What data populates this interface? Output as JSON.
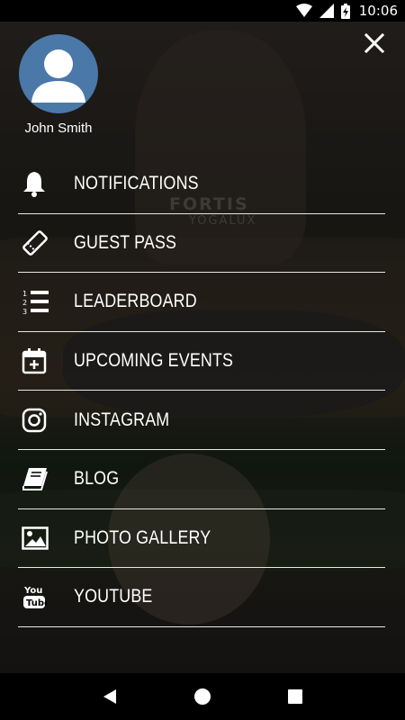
{
  "status_bar": {
    "time": "10:06",
    "icons": [
      "wifi-icon",
      "cellular-icon",
      "battery-charging-icon"
    ]
  },
  "drawer": {
    "close_icon": "close-icon",
    "user": {
      "name": "John Smith",
      "avatar_icon": "default-avatar-icon"
    },
    "menu": [
      {
        "label": "NOTIFICATIONS",
        "icon": "bell-icon"
      },
      {
        "label": "GUEST PASS",
        "icon": "ticket-icon"
      },
      {
        "label": "LEADERBOARD",
        "icon": "numbered-list-icon"
      },
      {
        "label": "UPCOMING EVENTS",
        "icon": "calendar-add-icon"
      },
      {
        "label": "INSTAGRAM",
        "icon": "instagram-icon"
      },
      {
        "label": "BLOG",
        "icon": "book-icon"
      },
      {
        "label": "PHOTO GALLERY",
        "icon": "image-icon"
      },
      {
        "label": "YOUTUBE",
        "icon": "youtube-icon"
      }
    ]
  },
  "background": {
    "shirt_text_line1": "FORTIS",
    "shirt_text_line2": "YOGALUX"
  },
  "nav_bar": {
    "buttons": [
      "back-icon",
      "home-icon",
      "recents-icon"
    ]
  },
  "colors": {
    "avatar": "#4a78a8",
    "text": "#ffffff",
    "divider": "#e8e8e8"
  }
}
